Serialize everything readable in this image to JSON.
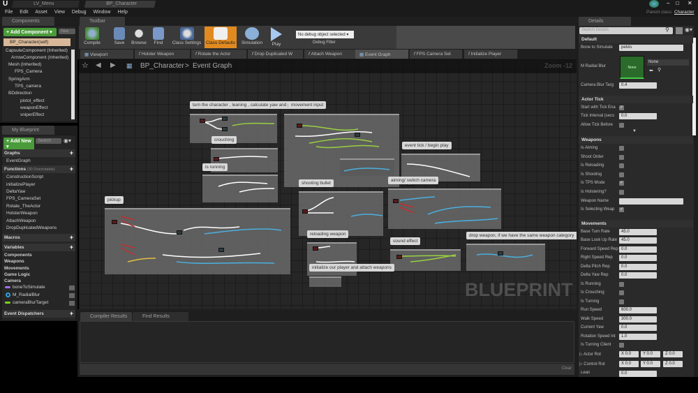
{
  "window": {
    "tabs": [
      "LV_Menu",
      "BP_Character"
    ],
    "parent_class_label": "Parent class:",
    "parent_class": "Character"
  },
  "menu": [
    "File",
    "Edit",
    "Asset",
    "View",
    "Debug",
    "Window",
    "Help"
  ],
  "components": {
    "tab": "Components",
    "add_label": "+ Add Component ▾",
    "search_placeholder": "Sea",
    "self": "BP_Character(self)",
    "tree": [
      "CapsuleComponent (Inherited)",
      "ArrowComponent (Inherited)",
      "Mesh (Inherited)",
      "FPS_Camera",
      "SpringArm",
      "TPS_camera",
      "BDdirection",
      "pistol_effect",
      "weaponEffect",
      "sniperEffect"
    ]
  },
  "my_blueprint": {
    "tab": "My Blueprint",
    "add_label": "+ Add New ▾",
    "search_placeholder": "Search",
    "graphs_label": "Graphs",
    "graphs": [
      "EventGraph"
    ],
    "functions_label": "Functions",
    "functions_count": "(30 Overridable)",
    "functions": [
      "ConstructionScript",
      "initializePlayer",
      "DeltaYaw",
      "FPS_CameraSet",
      "Rotate_TheActor",
      "HolsterWeapon",
      "AttachWeapon",
      "DropDuplicatedWeapons"
    ],
    "macros_label": "Macros",
    "variables_label": "Variables",
    "var_categories": [
      "Components",
      "Weapons",
      "Movements",
      "Game Logic",
      "Camera"
    ],
    "variables": [
      {
        "name": "boneToSimulate",
        "color": "#a070e0"
      },
      {
        "name": "M_RadialBlur",
        "color": "#30a0e0"
      },
      {
        "name": "cameraBlurTarget",
        "color": "#80d020"
      }
    ],
    "dispatchers_label": "Event Dispatchers"
  },
  "toolbar": {
    "tab": "Toolbar",
    "buttons": [
      "Compile",
      "Save",
      "Browse",
      "Find",
      "Class Settings",
      "Class Defaults",
      "Simulation",
      "Play"
    ],
    "debug_select": "No debug object selected ▾",
    "debug_label": "Debug Filter"
  },
  "doc_tabs": [
    "Viewport",
    "Holster Weapon",
    "Rotate the Actor",
    "Drop Duplicated W",
    "Attach Weapon",
    "Event Graph",
    "FPS Camera Set",
    "Initialize Player"
  ],
  "graph": {
    "breadcrumb_root": "BP_Character",
    "breadcrumb_sep": ">",
    "breadcrumb_current": "Event Graph",
    "zoom": "Zoom -12",
    "watermark": "BLUEPRINT",
    "comments": [
      "turn the character , leaning , calculate yaw and pitch",
      "movement input",
      "crouching",
      "is running",
      "event tick / begin play",
      "pickup",
      "shooting bullet",
      "aiming/ switch camera",
      "reloading weapon",
      "sound effect",
      "drop weapon, if we have the same weapon category",
      "initialize our player and attach weapons"
    ]
  },
  "bottom": {
    "tabs": [
      "Compiler Results",
      "Find Results"
    ],
    "clear": "Clear"
  },
  "details": {
    "tab": "Details",
    "search_placeholder": "Search Details",
    "default": {
      "label": "Default",
      "bone_label": "Bone to Simulate",
      "bone_value": "pelvis",
      "blur_label": "M Radial Blur",
      "blur_thumb": "None",
      "blur_value": "None",
      "cam_label": "Camera Blur Targ",
      "cam_value": "0.4"
    },
    "actor_tick": {
      "label": "Actor Tick",
      "rows": [
        {
          "label": "Start with Tick Ena",
          "checked": true
        },
        {
          "label": "Tick Interval (secs",
          "value": "0.0"
        },
        {
          "label": "Allow Tick Before",
          "checked": false
        }
      ]
    },
    "weapons": {
      "label": "Weapons",
      "rows": [
        {
          "label": "Is Aiming",
          "checked": false
        },
        {
          "label": "Shoot Order",
          "checked": false
        },
        {
          "label": "Is Reloading",
          "checked": false
        },
        {
          "label": "Is Shooting",
          "checked": false
        },
        {
          "label": "Is TPS Mode",
          "checked": true
        },
        {
          "label": "Is Holstering?",
          "checked": false
        },
        {
          "label": "Weapon Name",
          "value": ""
        },
        {
          "label": "Is Selecting Weap",
          "checked": true
        }
      ]
    },
    "movements": {
      "label": "Movements",
      "rows": [
        {
          "label": "Base Turn Rate",
          "value": "45.0"
        },
        {
          "label": "Base Look Up Rate",
          "value": "45.0"
        },
        {
          "label": "Forward Speed Rep",
          "value": "0.0"
        },
        {
          "label": "Right Speed Rep",
          "value": "0.0"
        },
        {
          "label": "Delta Pitch Rep",
          "value": "0.0"
        },
        {
          "label": "Delta Yaw Rep",
          "value": "0.0"
        },
        {
          "label": "Is Running",
          "checked": false
        },
        {
          "label": "Is Crouching",
          "checked": false
        },
        {
          "label": "Is Turning",
          "checked": false
        },
        {
          "label": "Run Speed",
          "value": "600.0"
        },
        {
          "label": "Walk Speed",
          "value": "300.0"
        },
        {
          "label": "Current Yaw",
          "value": "0.0"
        },
        {
          "label": "Rotation Speed Int",
          "value": "1.0"
        },
        {
          "label": "Is Turning Client",
          "checked": false
        }
      ],
      "actor_rot": {
        "label": "Actor Rot",
        "x": "X 0.0",
        "y": "Y 0.0",
        "z": "Z 0.0"
      },
      "control_rot": {
        "label": "Control Rot",
        "x": "X 0.0",
        "y": "Y 0.0",
        "z": "Z 0.0"
      },
      "lean": {
        "label": "Lean",
        "value": "0.0"
      }
    }
  }
}
